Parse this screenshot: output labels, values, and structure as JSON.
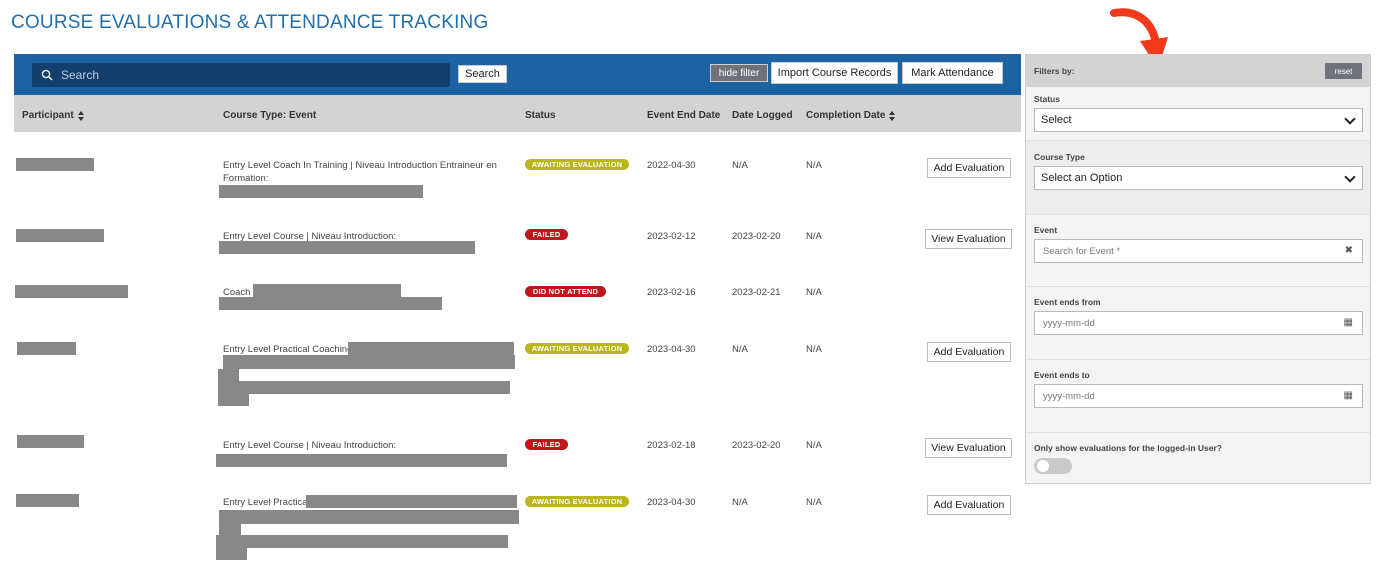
{
  "page": {
    "title": "COURSE EVALUATIONS & ATTENDANCE TRACKING"
  },
  "toolbar": {
    "search_placeholder": "Search",
    "search_button": "Search",
    "hide_filter": "hide filter",
    "import_button": "Import Course Records",
    "mark_button": "Mark Attendance"
  },
  "table": {
    "headers": {
      "participant": "Participant",
      "course": "Course Type: Event",
      "status": "Status",
      "end_date": "Event End Date",
      "logged": "Date Logged",
      "completion": "Completion Date"
    },
    "rows": [
      {
        "course": "Entry Level Coach In Training | Niveau Introduction Entraineur en",
        "course2": "Formation:",
        "status": "AWAITING EVALUATION",
        "end_date": "2022-04-30",
        "logged": "N/A",
        "completion": "N/A",
        "action": "Add Evaluation"
      },
      {
        "course": "Entry Level Course | Niveau Introduction:",
        "status": "FAILED",
        "end_date": "2023-02-12",
        "logged": "2023-02-20",
        "completion": "N/A",
        "action": "View Evaluation"
      },
      {
        "course": "Coach",
        "status": "DID NOT ATTEND",
        "end_date": "2023-02-16",
        "logged": "2023-02-21",
        "completion": "N/A",
        "action": ""
      },
      {
        "course": "Entry Level Practical Coaching",
        "status": "AWAITING EVALUATION",
        "end_date": "2023-04-30",
        "logged": "N/A",
        "completion": "N/A",
        "action": "Add Evaluation"
      },
      {
        "course": "Entry Level Course | Niveau Introduction:",
        "status": "FAILED",
        "end_date": "2023-02-18",
        "logged": "2023-02-20",
        "completion": "N/A",
        "action": "View Evaluation"
      },
      {
        "course": "Entry Level Practical",
        "status": "AWAITING EVALUATION",
        "end_date": "2023-04-30",
        "logged": "N/A",
        "completion": "N/A",
        "action": "Add Evaluation"
      }
    ]
  },
  "filters": {
    "title": "Filters by:",
    "reset": "reset",
    "status_label": "Status",
    "status_value": "Select",
    "course_type_label": "Course Type",
    "course_type_value": "Select an Option",
    "event_label": "Event",
    "event_placeholder": "Search for Event *",
    "ends_from_label": "Event ends from",
    "ends_from_placeholder": "yyyy-mm-dd",
    "ends_to_label": "Event ends to",
    "ends_to_placeholder": "yyyy-mm-dd",
    "logged_in_label": "Only show evaluations for the logged-in User?"
  },
  "colors": {
    "accent_blue": "#1d63a3",
    "awaiting": "#b9b51a",
    "failed": "#c0161e",
    "arrow": "#f23a1b"
  }
}
